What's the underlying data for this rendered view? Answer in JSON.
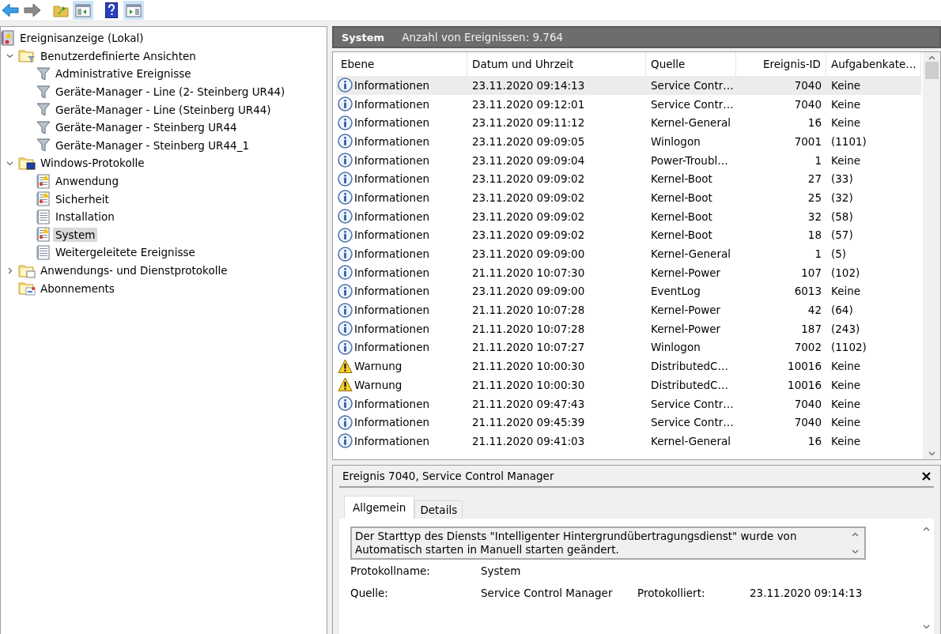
{
  "toolbar": {
    "buttons": [
      {
        "kind": "back",
        "selected": false
      },
      {
        "kind": "forward",
        "selected": false
      },
      {
        "kind": "up",
        "selected": false
      },
      {
        "kind": "hide-tree",
        "selected": true
      },
      {
        "kind": "help",
        "selected": false
      },
      {
        "kind": "show-actions",
        "selected": true
      }
    ]
  },
  "tree": [
    {
      "label": "Ereignisanzeige (Lokal)",
      "kind": "root",
      "selected": false,
      "children": [
        {
          "label": "Benutzerdefinierte Ansichten",
          "kind": "filter-folder",
          "expanded": true,
          "selected": false,
          "children": [
            {
              "label": "Administrative Ereignisse",
              "kind": "filter",
              "selected": false
            },
            {
              "label": "Geräte-Manager - Line (2- Steinberg UR44)",
              "kind": "filter",
              "selected": false
            },
            {
              "label": "Geräte-Manager - Line (Steinberg UR44)",
              "kind": "filter",
              "selected": false
            },
            {
              "label": "Geräte-Manager - Steinberg UR44",
              "kind": "filter",
              "selected": false
            },
            {
              "label": "Geräte-Manager - Steinberg UR44_1",
              "kind": "filter",
              "selected": false
            }
          ]
        },
        {
          "label": "Windows-Protokolle",
          "kind": "windows-folder",
          "expanded": true,
          "selected": false,
          "children": [
            {
              "label": "Anwendung",
              "kind": "log-alert",
              "selected": false
            },
            {
              "label": "Sicherheit",
              "kind": "log-alert",
              "selected": false
            },
            {
              "label": "Installation",
              "kind": "log",
              "selected": false
            },
            {
              "label": "System",
              "kind": "log-alert",
              "selected": true
            },
            {
              "label": "Weitergeleitete Ereignisse",
              "kind": "log",
              "selected": false
            }
          ]
        },
        {
          "label": "Anwendungs- und Dienstprotokolle",
          "kind": "folder",
          "expanded": false,
          "selected": false
        },
        {
          "label": "Abonnements",
          "kind": "subscriptions",
          "selected": false
        }
      ]
    }
  ],
  "log_header": {
    "title": "System",
    "count": "Anzahl von Ereignissen: 9.764"
  },
  "table": {
    "columns": [
      "Ebene",
      "Datum und Uhrzeit",
      "Quelle",
      "Ereignis-ID",
      "Aufgabenkate…"
    ],
    "rows": [
      {
        "kind": "info",
        "level": "Informationen",
        "date": "23.11.2020 09:14:13",
        "source": "Service Contr…",
        "id": "7040",
        "task": "Keine",
        "selected": true
      },
      {
        "kind": "info",
        "level": "Informationen",
        "date": "23.11.2020 09:12:01",
        "source": "Service Contr…",
        "id": "7040",
        "task": "Keine",
        "selected": false
      },
      {
        "kind": "info",
        "level": "Informationen",
        "date": "23.11.2020 09:11:12",
        "source": "Kernel-General",
        "id": "16",
        "task": "Keine",
        "selected": false
      },
      {
        "kind": "info",
        "level": "Informationen",
        "date": "23.11.2020 09:09:05",
        "source": "Winlogon",
        "id": "7001",
        "task": "(1101)",
        "selected": false
      },
      {
        "kind": "info",
        "level": "Informationen",
        "date": "23.11.2020 09:09:04",
        "source": "Power-Troubl…",
        "id": "1",
        "task": "Keine",
        "selected": false
      },
      {
        "kind": "info",
        "level": "Informationen",
        "date": "23.11.2020 09:09:02",
        "source": "Kernel-Boot",
        "id": "27",
        "task": "(33)",
        "selected": false
      },
      {
        "kind": "info",
        "level": "Informationen",
        "date": "23.11.2020 09:09:02",
        "source": "Kernel-Boot",
        "id": "25",
        "task": "(32)",
        "selected": false
      },
      {
        "kind": "info",
        "level": "Informationen",
        "date": "23.11.2020 09:09:02",
        "source": "Kernel-Boot",
        "id": "32",
        "task": "(58)",
        "selected": false
      },
      {
        "kind": "info",
        "level": "Informationen",
        "date": "23.11.2020 09:09:02",
        "source": "Kernel-Boot",
        "id": "18",
        "task": "(57)",
        "selected": false
      },
      {
        "kind": "info",
        "level": "Informationen",
        "date": "23.11.2020 09:09:00",
        "source": "Kernel-General",
        "id": "1",
        "task": "(5)",
        "selected": false
      },
      {
        "kind": "info",
        "level": "Informationen",
        "date": "21.11.2020 10:07:30",
        "source": "Kernel-Power",
        "id": "107",
        "task": "(102)",
        "selected": false
      },
      {
        "kind": "info",
        "level": "Informationen",
        "date": "23.11.2020 09:09:00",
        "source": "EventLog",
        "id": "6013",
        "task": "Keine",
        "selected": false
      },
      {
        "kind": "info",
        "level": "Informationen",
        "date": "21.11.2020 10:07:28",
        "source": "Kernel-Power",
        "id": "42",
        "task": "(64)",
        "selected": false
      },
      {
        "kind": "info",
        "level": "Informationen",
        "date": "21.11.2020 10:07:28",
        "source": "Kernel-Power",
        "id": "187",
        "task": "(243)",
        "selected": false
      },
      {
        "kind": "info",
        "level": "Informationen",
        "date": "21.11.2020 10:07:27",
        "source": "Winlogon",
        "id": "7002",
        "task": "(1102)",
        "selected": false
      },
      {
        "kind": "warning",
        "level": "Warnung",
        "date": "21.11.2020 10:00:30",
        "source": "DistributedC…",
        "id": "10016",
        "task": "Keine",
        "selected": false
      },
      {
        "kind": "warning",
        "level": "Warnung",
        "date": "21.11.2020 10:00:30",
        "source": "DistributedC…",
        "id": "10016",
        "task": "Keine",
        "selected": false
      },
      {
        "kind": "info",
        "level": "Informationen",
        "date": "21.11.2020 09:47:43",
        "source": "Service Contr…",
        "id": "7040",
        "task": "Keine",
        "selected": false
      },
      {
        "kind": "info",
        "level": "Informationen",
        "date": "21.11.2020 09:45:39",
        "source": "Service Contr…",
        "id": "7040",
        "task": "Keine",
        "selected": false
      },
      {
        "kind": "info",
        "level": "Informationen",
        "date": "21.11.2020 09:41:03",
        "source": "Kernel-General",
        "id": "16",
        "task": "Keine",
        "selected": false
      }
    ]
  },
  "details": {
    "title": "Ereignis 7040, Service Control Manager",
    "tabs": [
      {
        "label": "Allgemein",
        "selected": true
      },
      {
        "label": "Details",
        "selected": false
      }
    ],
    "message": "Der Starttyp des Diensts \"Intelligenter Hintergrundübertragungsdienst\" wurde von Automatisch starten in Manuell starten geändert.",
    "fields": [
      {
        "label": "Protokollname:",
        "value": "System"
      },
      {
        "label": "Quelle:",
        "value": "Service Control Manager",
        "extra_label": "Protokolliert:",
        "extra_value": "23.11.2020 09:14:13"
      }
    ]
  }
}
